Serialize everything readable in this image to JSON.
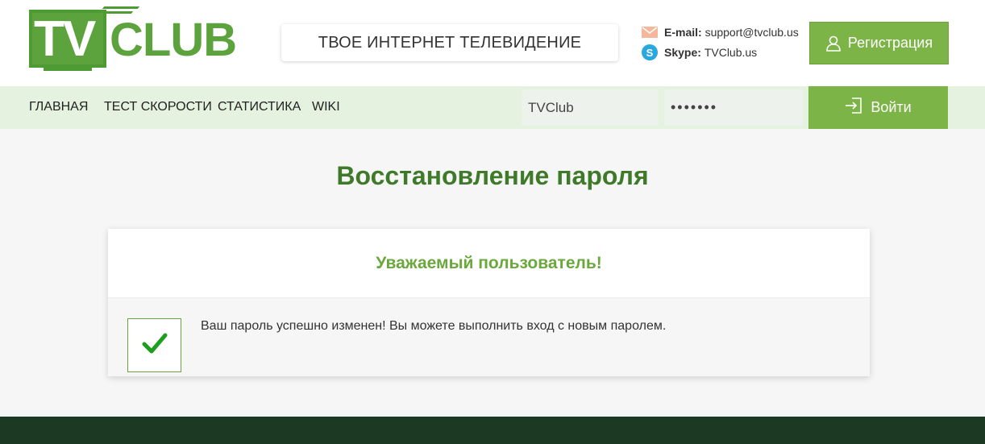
{
  "brand": {
    "logo_text_tv": "TV",
    "logo_text_club": "CLUB"
  },
  "header": {
    "slogan": "ТВОЕ ИНТЕРНЕТ ТЕЛЕВИДЕНИЕ",
    "email_label": "E-mail:",
    "email_value": "support@tvclub.us",
    "skype_label": "Skype:",
    "skype_value": "TVClub.us",
    "register_label": "Регистрация"
  },
  "nav": {
    "items": [
      "ГЛАВНАЯ",
      "ТЕСТ СКОРОСТИ",
      "СТАТИСТИКА",
      "WIKI"
    ],
    "login_value": "TVClub",
    "password_value": "•••••••",
    "login_button": "Войти"
  },
  "main": {
    "title": "Восстановление пароля",
    "card_heading": "Уважаемый пользователь!",
    "card_message": "Ваш пароль успешно изменен! Вы можете выполнить вход с новым паролем."
  },
  "colors": {
    "accent": "#7cb447",
    "title_green": "#3f7a2a",
    "nav_bg": "#e4f2df",
    "footer_bg": "#1c3a23"
  },
  "icons": {
    "mail": "mail-icon",
    "skype": "skype-icon",
    "user": "user-icon",
    "login": "login-icon",
    "check": "check-icon"
  }
}
